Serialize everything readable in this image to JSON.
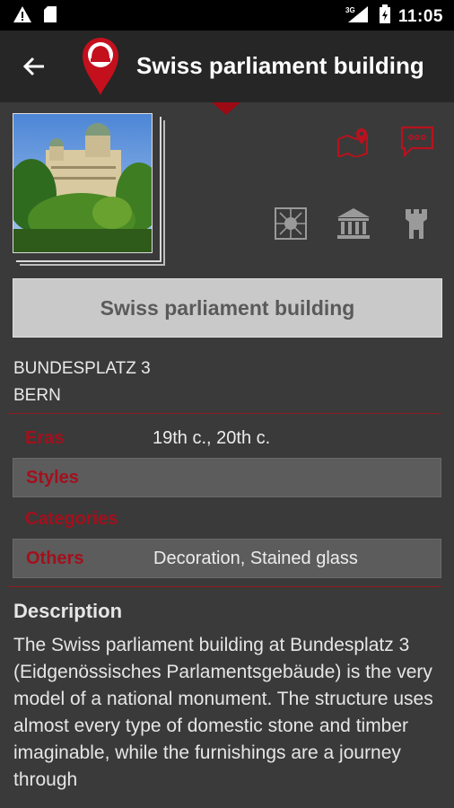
{
  "status_bar": {
    "time": "11:05",
    "network": "3G"
  },
  "app_bar": {
    "title": "Swiss parliament building"
  },
  "actions": {
    "map_icon": "map-pin-icon",
    "comment_icon": "speech-bubble-icon",
    "category_icons": [
      "art-nouveau-icon",
      "museum-icon",
      "tower-icon"
    ]
  },
  "place": {
    "name": "Swiss parliament building",
    "address_line1": "BUNDESPLATZ 3",
    "address_line2": "BERN"
  },
  "details": [
    {
      "label": "Eras",
      "value": "19th c., 20th c."
    },
    {
      "label": "Styles",
      "value": ""
    },
    {
      "label": "Categories",
      "value": ""
    },
    {
      "label": "Others",
      "value": "Decoration, Stained glass"
    }
  ],
  "description": {
    "heading": "Description",
    "text": "The Swiss parliament building at Bundesplatz 3 (Eidgenössisches Parlamentsgebäude) is the very model of a national monument. The structure uses almost every type of domestic stone and timber imaginable, while the furnishings are a journey through"
  },
  "colors": {
    "accent": "#a3101c",
    "background": "#3a3a3a",
    "app_bar": "#262626"
  }
}
